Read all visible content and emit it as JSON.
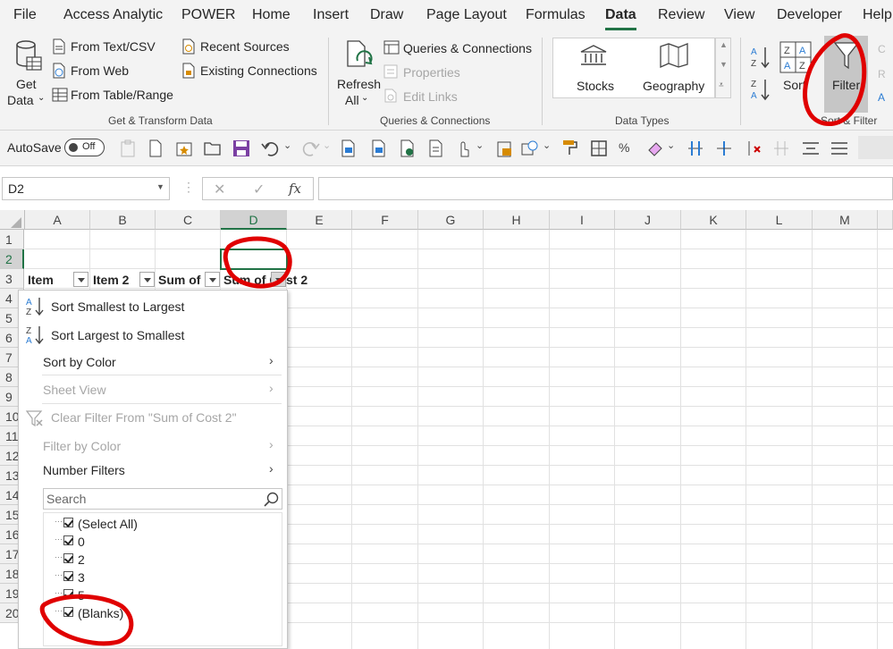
{
  "tabs": [
    "File",
    "Access Analytic",
    "POWER",
    "Home",
    "Insert",
    "Draw",
    "Page Layout",
    "Formulas",
    "Data",
    "Review",
    "View",
    "Developer",
    "Help"
  ],
  "ribbon": {
    "get_data": "Get",
    "get_data_2": "Data",
    "from_text_csv": "From Text/CSV",
    "from_web": "From Web",
    "from_table_range": "From Table/Range",
    "recent_sources": "Recent Sources",
    "existing_connections": "Existing Connections",
    "group_get_transform": "Get & Transform Data",
    "refresh": "Refresh",
    "refresh_all": "All",
    "queries_connections": "Queries & Connections",
    "properties": "Properties",
    "edit_links": "Edit Links",
    "group_queries": "Queries & Connections",
    "stocks": "Stocks",
    "geography": "Geography",
    "group_data_types": "Data Types",
    "sort": "Sort",
    "filter": "Filter",
    "group_sort_filter": "Sort & Filter"
  },
  "qat": {
    "autosave": "AutoSave",
    "toggle": "Off"
  },
  "formula_bar": {
    "name_box": "D2",
    "cancel": "✕",
    "enter": "✓",
    "fx": "fx"
  },
  "columns": [
    "A",
    "B",
    "C",
    "D",
    "E",
    "F",
    "G",
    "H",
    "I",
    "J",
    "K",
    "L",
    "M"
  ],
  "rows": [
    "1",
    "2",
    "3",
    "4",
    "5",
    "6",
    "7",
    "8",
    "9",
    "10",
    "11",
    "12",
    "13",
    "14",
    "15",
    "16",
    "17",
    "18",
    "19",
    "20"
  ],
  "header_row": {
    "a": "Item",
    "b": "Item 2",
    "c": "Sum of",
    "d": "Sum of Cost 2"
  },
  "menu": {
    "sort_asc": "Sort Smallest to Largest",
    "sort_desc": "Sort Largest to Smallest",
    "sort_color": "Sort by Color",
    "sheet_view": "Sheet View",
    "clear_filter": "Clear Filter From \"Sum of Cost 2\"",
    "filter_color": "Filter by Color",
    "number_filters": "Number Filters",
    "search_placeholder": "Search",
    "items": [
      "(Select All)",
      "0",
      "2",
      "3",
      "5",
      "(Blanks)"
    ]
  },
  "colors": {
    "excel_green": "#217346",
    "annotation_red": "#e00000"
  }
}
